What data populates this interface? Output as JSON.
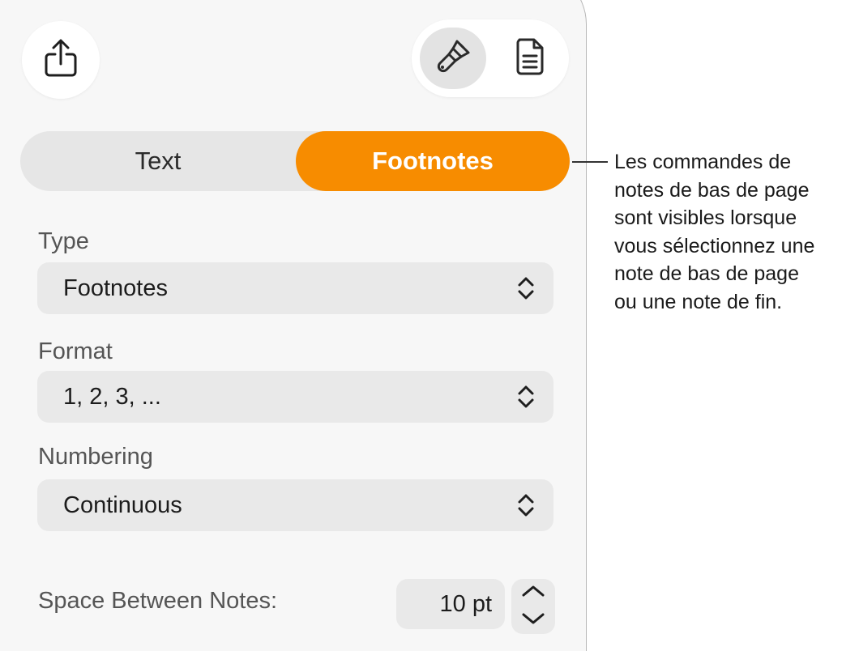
{
  "toolbar": {
    "share_icon": "share-icon",
    "format_icon": "paintbrush-icon",
    "document_icon": "document-icon"
  },
  "tabs": {
    "text": "Text",
    "footnotes": "Footnotes",
    "active": "Footnotes",
    "active_color": "#f78c00"
  },
  "type": {
    "label": "Type",
    "value": "Footnotes"
  },
  "format": {
    "label": "Format",
    "value": "1, 2, 3, ..."
  },
  "numbering": {
    "label": "Numbering",
    "value": "Continuous"
  },
  "spacing": {
    "label": "Space Between Notes:",
    "value": "10 pt"
  },
  "callout": {
    "lines": [
      "Les commandes de",
      "notes de bas de page",
      "sont visibles lorsque",
      "vous sélectionnez une",
      "note de bas de page",
      "ou une note de fin."
    ]
  }
}
